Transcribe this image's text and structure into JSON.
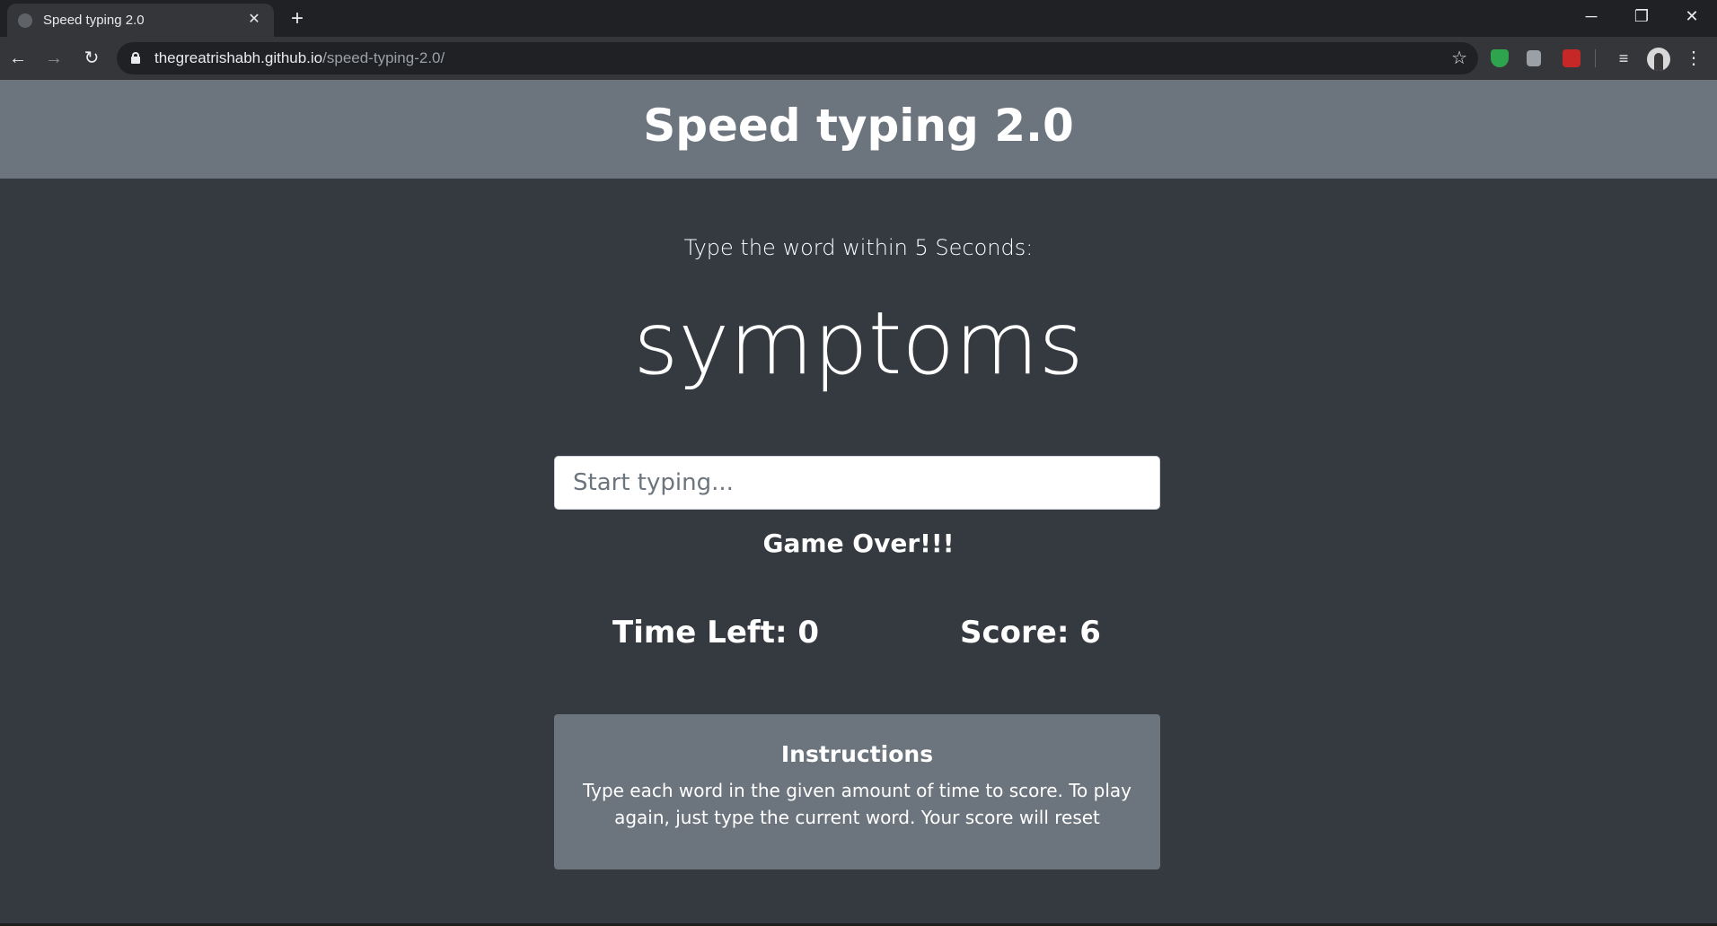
{
  "browser": {
    "tab_title": "Speed typing 2.0",
    "tab_close": "✕",
    "new_tab": "+",
    "url_domain": "thegreatrishabh.github.io",
    "url_path": "/speed-typing-2.0/",
    "icons": {
      "back": "←",
      "forward": "→",
      "reload": "↻",
      "star": "☆",
      "menu": "⋮",
      "minimize": "─",
      "restore": "❐",
      "close": "✕",
      "media": "≡"
    }
  },
  "page": {
    "title": "Speed typing 2.0",
    "lead_text": "Type the word within 5 Seconds:",
    "current_word": "symptoms",
    "input_placeholder": "Start typing...",
    "message": "Game Over!!!",
    "time_left_label": "Time Left: 0",
    "score_label": "Score: 6",
    "instructions": {
      "title": "Instructions",
      "body": "Type each word in the given amount of time to score. To play again, just type the current word. Your score will reset"
    }
  },
  "colors": {
    "page_bg": "#343a40",
    "header_bg": "#6c757d",
    "card_bg": "#6c757d",
    "text": "#ffffff"
  }
}
